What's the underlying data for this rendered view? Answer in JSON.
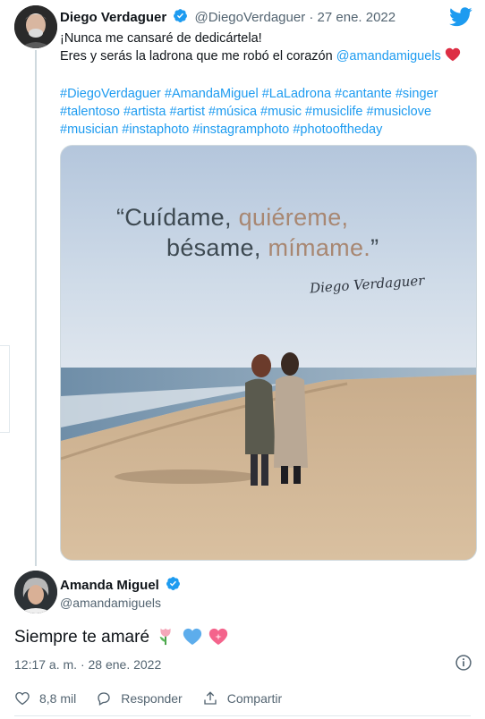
{
  "tweet": {
    "author_name": "Diego Verdaguer",
    "author_handle": "@DiegoVerdaguer",
    "separator": "·",
    "date": "27 ene. 2022",
    "line1": "¡Nunca me cansaré de dedicártela!",
    "line2_text": "Eres y serás la ladrona que me robó el corazón ",
    "line2_mention": "@amandamiguels",
    "hashtags_line1": "#DiegoVerdaguer #AmandaMiguel  #LaLadrona #cantante #singer",
    "hashtags_line2": "#talentoso #artista #artist #música #music #musiclife #musiclove",
    "hashtags_line3": "#musician #instaphoto #instagramphoto #photooftheday",
    "image": {
      "quote_part1": "“Cuídame, ",
      "quote_part1_accent": "quiéreme,",
      "quote_part2": "bésame, ",
      "quote_part2_accent": "mímame.",
      "quote_part2_end": "”",
      "signature": "Diego Verdaguer"
    }
  },
  "reply": {
    "author_name": "Amanda Miguel",
    "author_handle": "@amandamiguels",
    "text": "Siempre te amaré",
    "time": "12:17 a. m.",
    "separator": "·",
    "date": "28 ene. 2022"
  },
  "actions": {
    "likes": "8,8 mil",
    "reply_label": "Responder",
    "share_label": "Compartir"
  },
  "colors": {
    "link": "#1d9bf0",
    "heart": "#f91880",
    "verified": "#1d9bf0"
  },
  "icons": [
    "verified-badge-icon",
    "twitter-bird-icon",
    "red-heart-icon",
    "tulip-icon",
    "blue-heart-icon",
    "sparkling-heart-icon",
    "info-icon",
    "like-icon",
    "reply-icon",
    "share-icon"
  ]
}
